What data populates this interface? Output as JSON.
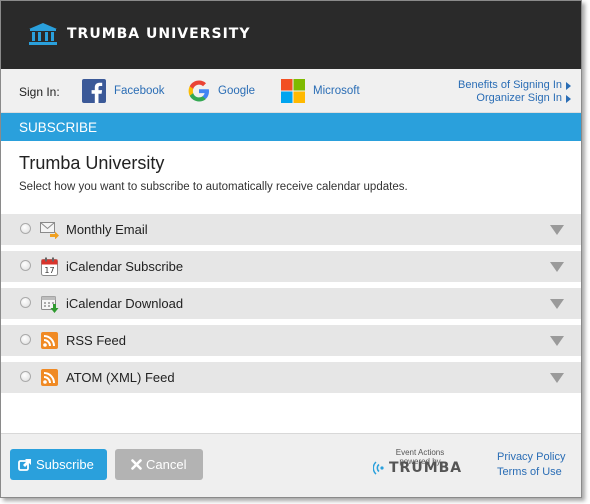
{
  "header": {
    "brand": "TRUMBA UNIVERSITY"
  },
  "signin": {
    "label": "Sign In:",
    "providers": [
      "Facebook",
      "Google",
      "Microsoft"
    ],
    "benefits_link": "Benefits of Signing In",
    "organizer_link": "Organizer Sign In"
  },
  "subscribe_bar": {
    "title": "SUBSCRIBE"
  },
  "main": {
    "title": "Trumba University",
    "description": "Select how you want to subscribe to automatically receive calendar updates."
  },
  "options": [
    {
      "label": "Monthly Email",
      "icon": "email-icon"
    },
    {
      "label": "iCalendar Subscribe",
      "icon": "calendar-icon"
    },
    {
      "label": "iCalendar Download",
      "icon": "calendar-download-icon"
    },
    {
      "label": "RSS Feed",
      "icon": "rss-icon"
    },
    {
      "label": "ATOM (XML) Feed",
      "icon": "rss-icon"
    }
  ],
  "footer": {
    "subscribe_label": "Subscribe",
    "cancel_label": "Cancel",
    "powered_line1": "Event Actions",
    "powered_line2": "powered by",
    "powered_brand": "TRUMBA",
    "privacy": "Privacy Policy",
    "terms": "Terms of Use"
  },
  "colors": {
    "accent": "#2aa0dc",
    "header_bg": "#2a2a2a",
    "link": "#2a6db5"
  }
}
